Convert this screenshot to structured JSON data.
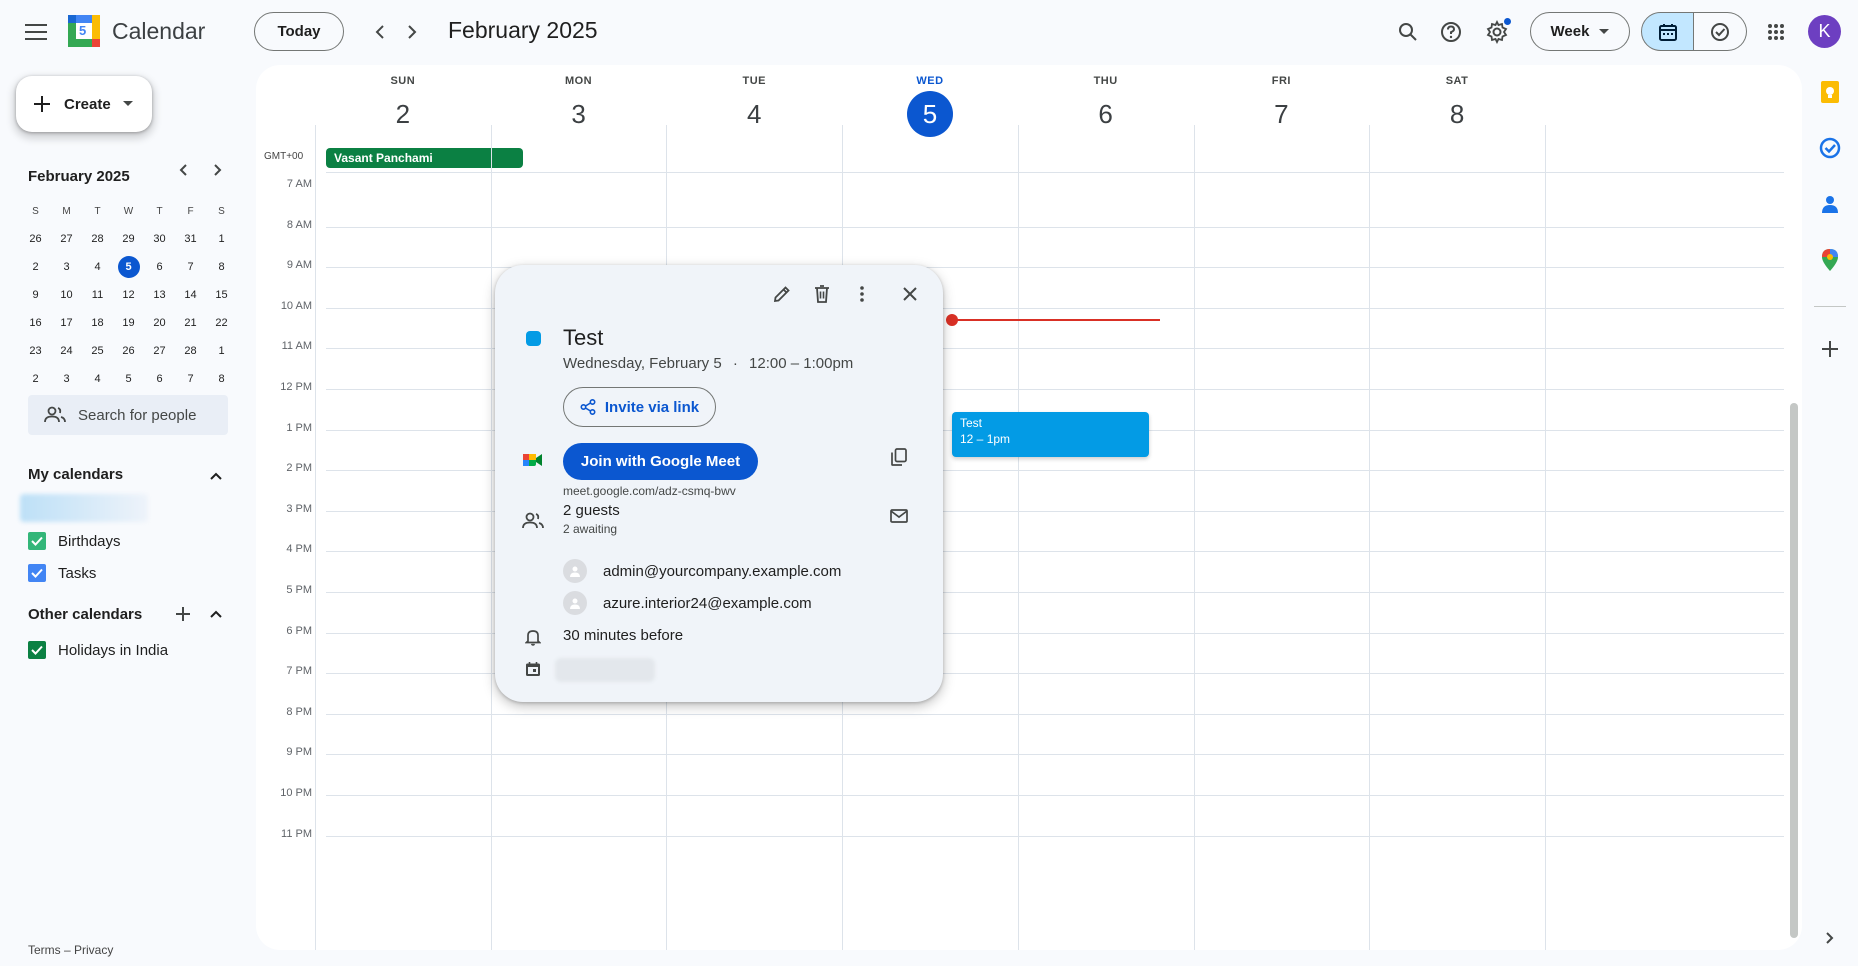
{
  "header": {
    "app_name": "Calendar",
    "logo_day": "5",
    "today_label": "Today",
    "month_title": "February 2025",
    "view_label": "Week",
    "avatar_letter": "K"
  },
  "sidebar": {
    "create_label": "Create",
    "mini_month": "February 2025",
    "dow": [
      "S",
      "M",
      "T",
      "W",
      "T",
      "F",
      "S"
    ],
    "weeks": [
      [
        "26",
        "27",
        "28",
        "29",
        "30",
        "31",
        "1"
      ],
      [
        "2",
        "3",
        "4",
        "5",
        "6",
        "7",
        "8"
      ],
      [
        "9",
        "10",
        "11",
        "12",
        "13",
        "14",
        "15"
      ],
      [
        "16",
        "17",
        "18",
        "19",
        "20",
        "21",
        "22"
      ],
      [
        "23",
        "24",
        "25",
        "26",
        "27",
        "28",
        "1"
      ],
      [
        "2",
        "3",
        "4",
        "5",
        "6",
        "7",
        "8"
      ]
    ],
    "search_people": "Search for people",
    "my_calendars_title": "My calendars",
    "my_calendars": [
      {
        "label": "Birthdays",
        "color": "#33b679"
      },
      {
        "label": "Tasks",
        "color": "#4285f4"
      }
    ],
    "other_calendars_title": "Other calendars",
    "other_calendars": [
      {
        "label": "Holidays in India",
        "color": "#0b8043"
      }
    ],
    "footer": "Terms – Privacy"
  },
  "week": {
    "timezone": "GMT+00",
    "days": [
      {
        "name": "SUN",
        "date": "2"
      },
      {
        "name": "MON",
        "date": "3"
      },
      {
        "name": "TUE",
        "date": "4"
      },
      {
        "name": "WED",
        "date": "5"
      },
      {
        "name": "THU",
        "date": "6"
      },
      {
        "name": "FRI",
        "date": "7"
      },
      {
        "name": "SAT",
        "date": "8"
      }
    ],
    "all_day_event": "Vasant Panchami",
    "hours": [
      "7 AM",
      "8 AM",
      "9 AM",
      "10 AM",
      "11 AM",
      "12 PM",
      "1 PM",
      "2 PM",
      "3 PM",
      "4 PM",
      "5 PM",
      "6 PM",
      "7 PM",
      "8 PM",
      "9 PM",
      "10 PM",
      "11 PM"
    ],
    "event": {
      "title": "Test",
      "time": "12 – 1pm",
      "color": "#039be5"
    }
  },
  "popup": {
    "title": "Test",
    "date": "Wednesday, February 5",
    "time": "12:00 – 1:00pm",
    "invite_label": "Invite via link",
    "meet_label": "Join with Google Meet",
    "meet_link": "meet.google.com/adz-csmq-bwv",
    "guests_count": "2 guests",
    "guests_status": "2 awaiting",
    "guests": [
      "admin@yourcompany.example.com",
      "azure.interior24@example.com"
    ],
    "reminder": "30 minutes before",
    "color": "#039be5"
  }
}
